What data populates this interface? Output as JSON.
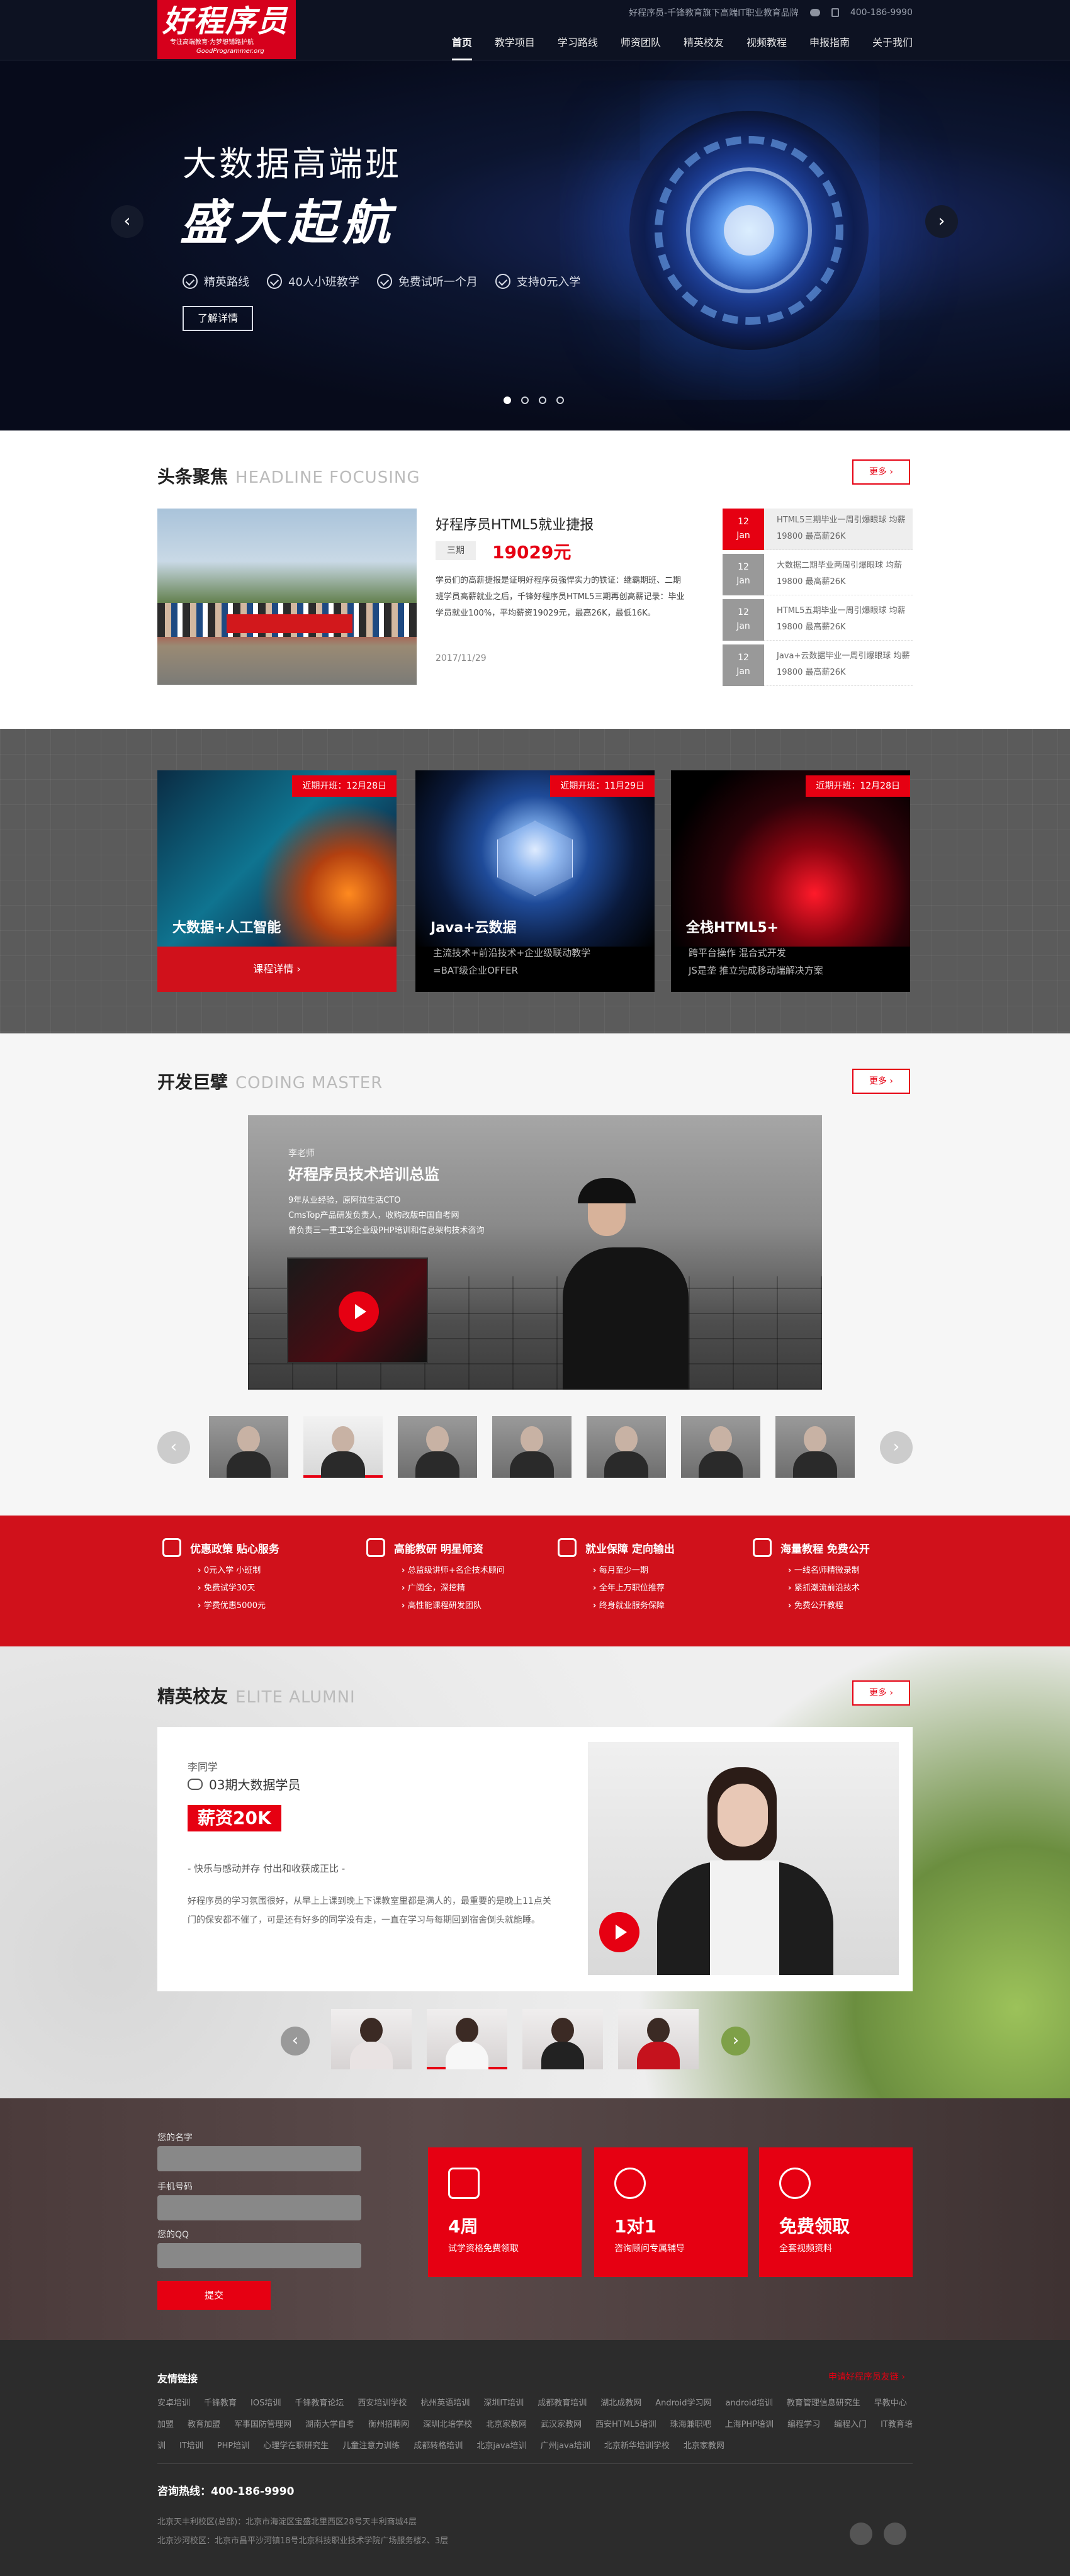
{
  "header": {
    "logo_main": "好程序员",
    "logo_sub": "专注高端教育·为梦想铺路护航",
    "logo_url": "GoodProgrammer.org",
    "slogan": "好程序员-千锋教育旗下高端IT职业教育品牌",
    "phone": "400-186-9990",
    "nav": [
      "首页",
      "教学项目",
      "学习路线",
      "师资团队",
      "精英校友",
      "视频教程",
      "申报指南",
      "关于我们"
    ]
  },
  "banner": {
    "title": "大数据高端班",
    "slogan": "盛大起航",
    "features": [
      "精英路线",
      "40人小班教学",
      "免费试听一个月",
      "支持0元入学"
    ],
    "button": "了解详情",
    "prev": "‹",
    "next": "›"
  },
  "headline": {
    "title_cn": "头条聚焦",
    "title_en": "HEADLINE FOCUSING",
    "more": "更多 ›",
    "article": {
      "title": "好程序员HTML5就业捷报",
      "tag": "三期",
      "price": "19029元",
      "desc": "学员们的高薪捷报是证明好程序员强悍实力的铁证：继霸期班、二期班学员高薪就业之后，千锋好程序员HTML5三期再创高薪记录：毕业学员就业100%，平均薪资19029元，最高26K，最低16K。",
      "date": "2017/11/29"
    },
    "news": [
      {
        "day": "12",
        "mon": "Jan",
        "text": "HTML5三期毕业一周引爆眼球 均薪19800 最高薪26K"
      },
      {
        "day": "12",
        "mon": "Jan",
        "text": "大数据二期毕业两周引爆眼球 均薪19800 最高薪26K"
      },
      {
        "day": "12",
        "mon": "Jan",
        "text": "HTML5五期毕业一周引爆眼球 均薪19800 最高薪26K"
      },
      {
        "day": "12",
        "mon": "Jan",
        "text": "Java+云数据毕业一周引爆眼球 均薪19800 最高薪26K"
      }
    ]
  },
  "courses": [
    {
      "tag": "近期开班：12月28日",
      "name": "大数据+人工智能",
      "action": "课程详情  ›"
    },
    {
      "tag": "近期开班：11月29日",
      "name": "Java+云数据",
      "desc1": "主流技术+前沿技术+企业级联动教学",
      "desc2": "=BAT级企业OFFER"
    },
    {
      "tag": "近期开班：12月28日",
      "name": "全栈HTML5+",
      "desc1": "跨平台操作 混合式开发",
      "desc2": "JS是垄 推立完成移动端解决方案"
    }
  ],
  "master": {
    "title_cn": "开发巨擘",
    "title_en": "CODING MASTER",
    "more": "更多 ›",
    "role": "李老师",
    "name": "好程序员技术培训总监",
    "lines": [
      "9年从业经验，原阿拉生活CTO",
      "CmsTop产品研发负责人，收购改版中国自考网",
      "曾负责三一重工等企业级PHP培训和信息架构技术咨询"
    ],
    "prev": "‹",
    "next": "›"
  },
  "features": [
    {
      "title": "优惠政策 贴心服务",
      "items": [
        "0元入学 小班制",
        "免费试学30天",
        "学费优惠5000元"
      ]
    },
    {
      "title": "高能教研 明星师资",
      "items": [
        "总监级讲师+名企技术顾问",
        "广阔全，深挖精",
        "高性能课程研发团队"
      ]
    },
    {
      "title": "就业保障 定向输出",
      "items": [
        "每月至少一期",
        "全年上万职位推荐",
        "终身就业服务保障"
      ]
    },
    {
      "title": "海量教程 免费公开",
      "items": [
        "一线名师精微录制",
        "紧抓潮流前沿技术",
        "免费公开教程"
      ]
    }
  ],
  "alumni": {
    "title_cn": "精英校友",
    "title_en": "ELITE ALUMNI",
    "more": "更多 ›",
    "name": "李同学",
    "class": "03期大数据学员",
    "salary": "薪资20K",
    "quote": "- 快乐与感动并存 付出和收获成正比 -",
    "text": "好程序员的学习氛围很好，从早上上课到晚上下课教室里都是满人的，最重要的是晚上11点关门的保安都不催了，可是还有好多的同学没有走，一直在学习与每期回到宿舍倒头就能睡。",
    "prev": "‹",
    "next": "›"
  },
  "contact": {
    "labels": [
      "您的名字",
      "手机号码",
      "您的QQ"
    ],
    "submit": "提交",
    "cards": [
      {
        "big": "4周",
        "small": "试学资格免费领取"
      },
      {
        "big": "1对1",
        "small": "咨询顾问专属辅导"
      },
      {
        "big": "免费领取",
        "small": "全套视频资料"
      }
    ]
  },
  "footer": {
    "links_title": "友情链接",
    "right_link": "申请好程序员友链 ›",
    "links": [
      "安卓培训",
      "千锋教育",
      "IOS培训",
      "千锋教育论坛",
      "西安培训学校",
      "杭州英语培训",
      "深圳IT培训",
      "成都教育培训",
      "湖北成教网",
      "Android学习网",
      "android培训",
      "教育管理信息研究生",
      "早教中心加盟",
      "教育加盟",
      "军事国防管理网",
      "湖南大学自考",
      "衡州招聘网",
      "深圳北培学校",
      "北京家教网",
      "武汉家教网",
      "西安HTML5培训",
      "珠海兼职吧",
      "上海PHP培训",
      "编程学习",
      "编程入门",
      "IT教育培训",
      "IT培训",
      "PHP培训",
      "心理学在职研究生",
      "儿童注意力训练",
      "成都转格培训",
      "北京java培训",
      "广州java培训",
      "北京新华培训学校",
      "北京家教网"
    ],
    "tel": "咨询热线：400-186-9990",
    "addr1": "北京天丰利校区(总部)：北京市海淀区宝盛北里西区28号天丰利商城4层",
    "addr2": "北京沙河校区：北京市昌平沙河镇18号北京科技职业技术学院广场服务楼2、3层"
  }
}
